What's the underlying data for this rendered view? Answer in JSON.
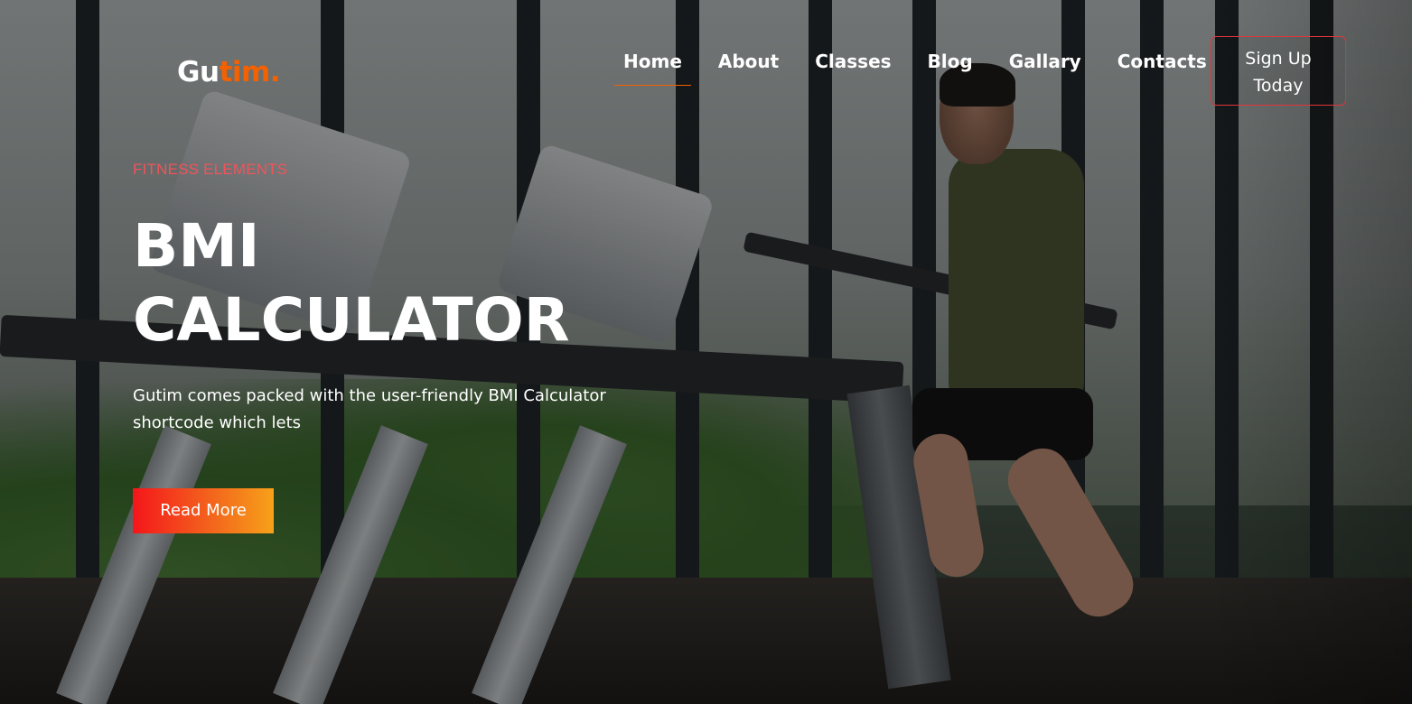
{
  "brand": {
    "logo_part1": "Gu",
    "logo_part2": "tim."
  },
  "nav": {
    "items": [
      {
        "label": "Home",
        "active": true
      },
      {
        "label": "About"
      },
      {
        "label": "Classes"
      },
      {
        "label": "Blog"
      },
      {
        "label": "Gallary"
      },
      {
        "label": "Contacts"
      }
    ],
    "signup_line1": "Sign Up",
    "signup_line2": "Today"
  },
  "hero": {
    "eyebrow": "FITNESS ELEMENTS",
    "headline_line1": "BMI",
    "headline_line2": "CALCULATOR",
    "description": "Gutim comes packed with the user-friendly BMI Calculator shortcode which lets",
    "cta_label": "Read More",
    "background": "gym-treadmill-photo"
  },
  "colors": {
    "accent": "#f36100",
    "eyebrow": "#f0545a",
    "signup_border": "#e0363a",
    "cta_gradient_start": "#f4161b",
    "cta_gradient_end": "#f7a11a"
  }
}
